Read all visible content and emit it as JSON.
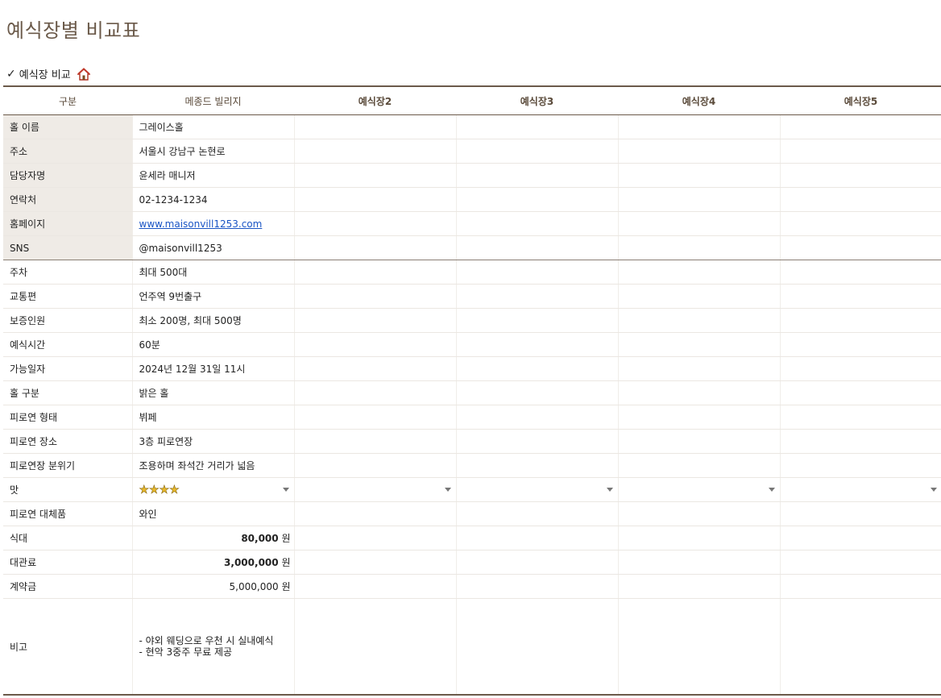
{
  "page": {
    "title": "예식장별 비교표",
    "section_label": "예식장 비교",
    "section_check": "✓"
  },
  "table": {
    "headers": [
      "구분",
      "메종드 빌리지",
      "예식장2",
      "예식장3",
      "예식장4",
      "예식장5"
    ],
    "rows": {
      "hall_name": {
        "label": "홀 이름",
        "value": "그레이스홀"
      },
      "address": {
        "label": "주소",
        "value": "서울시 강남구 논현로"
      },
      "manager": {
        "label": "담당자명",
        "value": "윤세라 매니저"
      },
      "phone": {
        "label": "연락처",
        "value": "02-1234-1234"
      },
      "homepage": {
        "label": "홈페이지",
        "value": " www.maisonvill1253.com "
      },
      "sns": {
        "label": "SNS",
        "value": "@maisonvill1253"
      },
      "parking": {
        "label": "주차",
        "value": "최대 500대"
      },
      "transport": {
        "label": "교통편",
        "value": "언주역 9번출구"
      },
      "guests": {
        "label": "보증인원",
        "value": "최소 200명, 최대 500명"
      },
      "duration": {
        "label": "예식시간",
        "value": "60분"
      },
      "available": {
        "label": "가능일자",
        "value": "2024년 12월 31일 11시"
      },
      "hall_type": {
        "label": "홀 구분",
        "value": "밝은 홀"
      },
      "banquet_type": {
        "label": "피로연 형태",
        "value": "뷔페"
      },
      "banquet_place": {
        "label": "피로연 장소",
        "value": "3층 피로연장"
      },
      "banquet_mood": {
        "label": "피로연장 분위기",
        "value": "조용하며 좌석간 거리가 넓음"
      },
      "taste": {
        "label": "맛",
        "value": "★★★★",
        "rating": 4
      },
      "alt_gift": {
        "label": "피로연 대체품",
        "value": "와인"
      },
      "meal_fee": {
        "label": "식대",
        "value": "80,000",
        "unit": "원"
      },
      "rental_fee": {
        "label": "대관료",
        "value": "3,000,000",
        "unit": "원"
      },
      "deposit": {
        "label": "계약금",
        "value": "5,000,000",
        "unit": "원"
      },
      "notes": {
        "label": "비고",
        "line1": "- 야외 웨딩으로 우천 시 실내예식",
        "line2": "- 현악 3중주 무료 제공"
      }
    }
  },
  "colors": {
    "title": "#6b5a4a",
    "header_rule": "#6b5a4a",
    "label_shade": "#efebe6",
    "link": "#1a55c5",
    "star": "#e8b82a"
  }
}
